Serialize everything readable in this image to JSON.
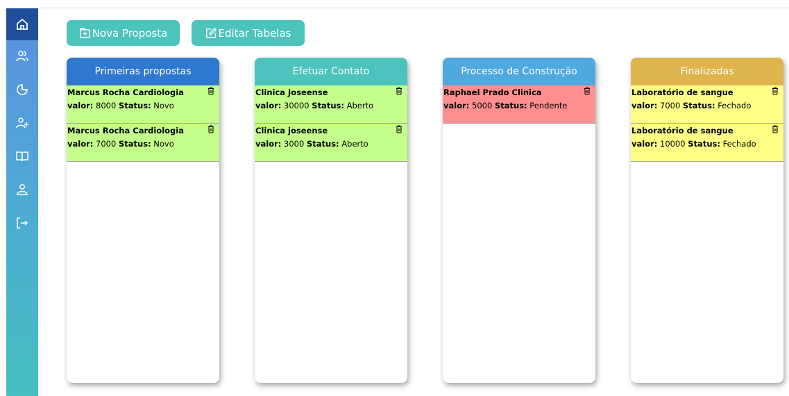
{
  "toolbar": {
    "new_proposal_label": "Nova Proposta",
    "edit_tables_label": "Editar Tabelas"
  },
  "sidebar": {
    "items": [
      {
        "icon": "home-icon"
      },
      {
        "icon": "users-icon"
      },
      {
        "icon": "pie-chart-icon"
      },
      {
        "icon": "user-plus-icon"
      },
      {
        "icon": "book-icon"
      },
      {
        "icon": "user-icon"
      },
      {
        "icon": "logout-icon"
      }
    ]
  },
  "labels": {
    "valor": "valor:",
    "status": "Status:"
  },
  "columns": [
    {
      "title": "Primeiras propostas",
      "header_color": "#2f78cf",
      "card_color": "#c3ff8a",
      "cards": [
        {
          "name": "Marcus Rocha Cardiologia",
          "valor": "8000",
          "status": "Novo"
        },
        {
          "name": "Marcus Rocha Cardiologia",
          "valor": "7000",
          "status": "Novo"
        }
      ]
    },
    {
      "title": "Efetuar Contato",
      "header_color": "#4cc3bd",
      "card_color": "#c3ff8a",
      "cards": [
        {
          "name": "Clinica Joseense",
          "valor": "30000",
          "status": "Aberto"
        },
        {
          "name": "Clinica joseense",
          "valor": "3000",
          "status": "Aberto"
        }
      ]
    },
    {
      "title": "Processo de Construção",
      "header_color": "#4fa9df",
      "card_color": "#ff8e8e",
      "cards": [
        {
          "name": "Raphael Prado Clinica",
          "valor": "5000",
          "status": "Pendente"
        }
      ]
    },
    {
      "title": "Finalizadas",
      "header_color": "#e0b44c",
      "card_color": "#ffff88",
      "cards": [
        {
          "name": "Laboratório de sangue",
          "valor": "7000",
          "status": "Fechado"
        },
        {
          "name": "Laboratório de sangue",
          "valor": "10000",
          "status": "Fechado"
        }
      ]
    }
  ]
}
